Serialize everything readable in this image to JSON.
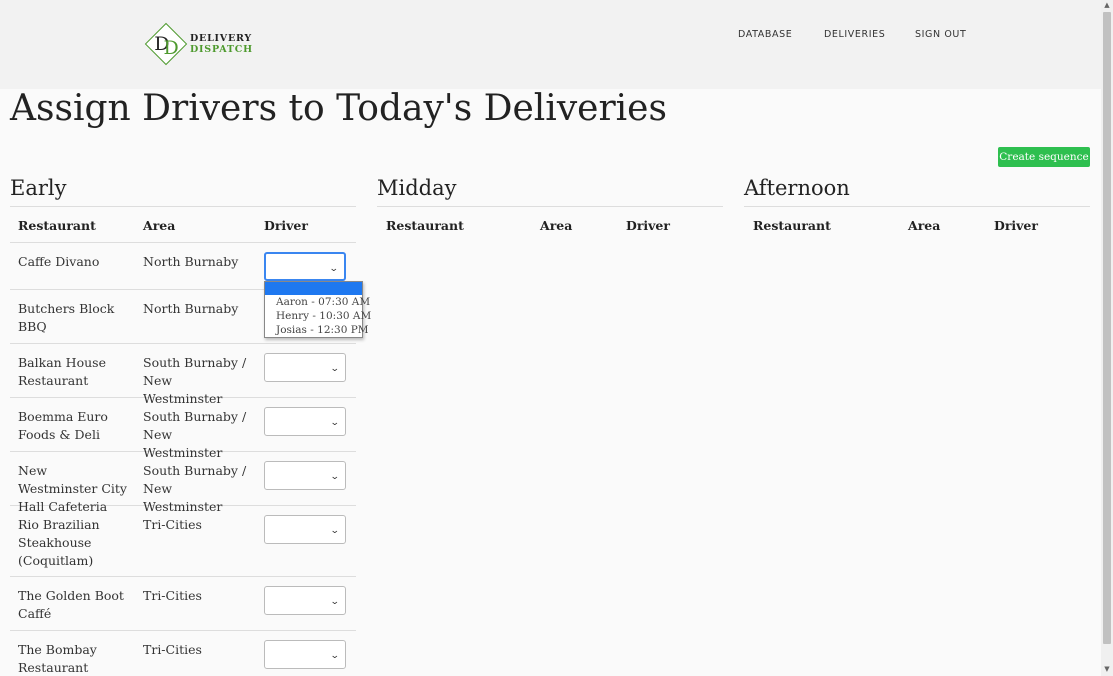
{
  "brand": {
    "mark": "DD",
    "line1": "DELIVERY",
    "line2": "DISPATCH"
  },
  "nav": {
    "database": "DATABASE",
    "deliveries": "DELIVERIES",
    "sign_out": "SIGN OUT"
  },
  "page_title": "Assign Drivers to Today's Deliveries",
  "create_button": "Create sequence",
  "headers": {
    "restaurant": "Restaurant",
    "area": "Area",
    "driver": "Driver"
  },
  "sections": {
    "early": "Early",
    "midday": "Midday",
    "afternoon": "Afternoon"
  },
  "early_rows": [
    {
      "restaurant": "Caffe Divano",
      "area": "North Burnaby"
    },
    {
      "restaurant": "Butchers Block BBQ",
      "area": "North Burnaby"
    },
    {
      "restaurant": "Balkan House Restaurant",
      "area": "South Burnaby / New Westminster"
    },
    {
      "restaurant": "Boemma Euro Foods & Deli",
      "area": "South Burnaby / New Westminster"
    },
    {
      "restaurant": "New Westminster City Hall Cafeteria",
      "area": "South Burnaby / New Westminster"
    },
    {
      "restaurant": "Rio Brazilian Steakhouse (Coquitlam)",
      "area": "Tri-Cities"
    },
    {
      "restaurant": "The Golden Boot Caffé",
      "area": "Tri-Cities"
    },
    {
      "restaurant": "The Bombay Restaurant",
      "area": "Tri-Cities"
    }
  ],
  "driver_options": [
    "",
    "Aaron - 07:30 AM",
    "Henry - 10:30 AM",
    "Josias - 12:30 PM"
  ],
  "icons": {
    "select_chevron": "chevron-down-icon",
    "scroll_up": "arrow-up-icon",
    "scroll_down": "arrow-down-icon"
  },
  "colors": {
    "accent_green": "#2ebf4f",
    "brand_green": "#4e9a2e",
    "selection_blue": "#1e78f0"
  }
}
